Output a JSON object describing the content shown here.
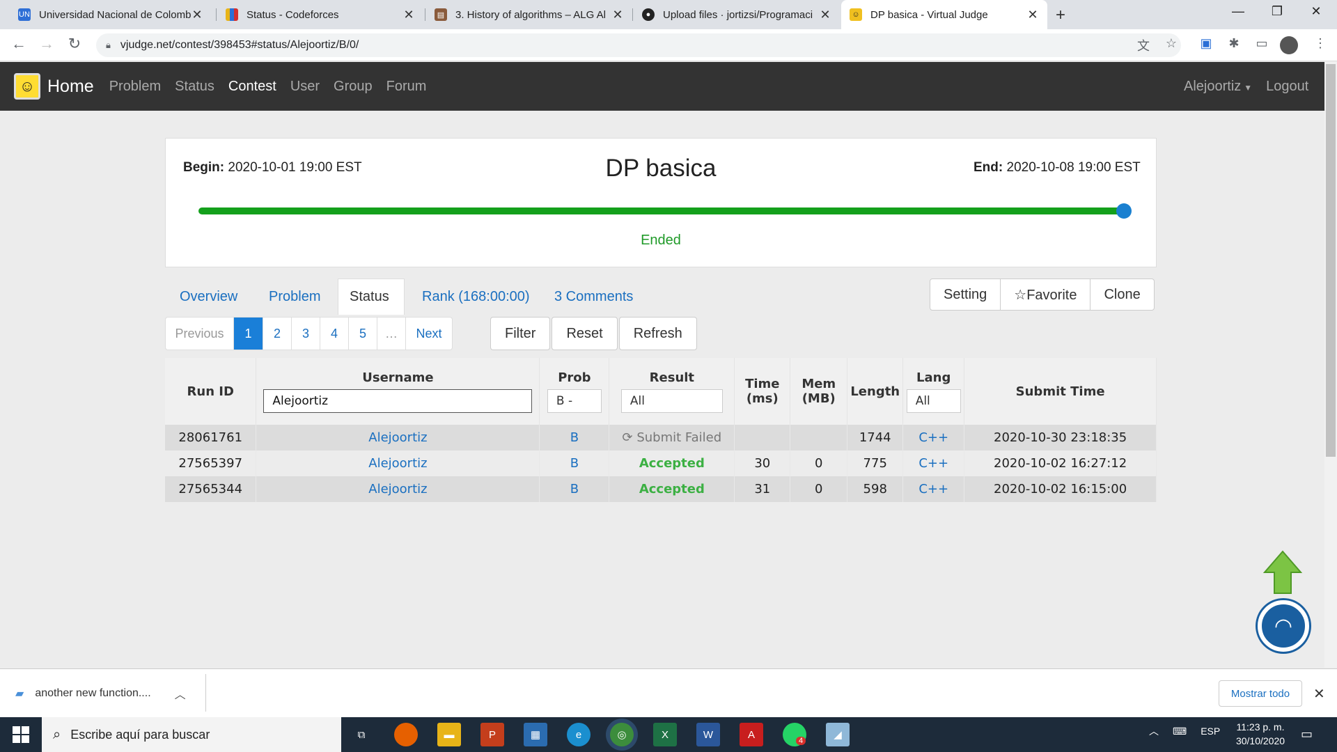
{
  "browser": {
    "tabs": [
      {
        "title": "Universidad Nacional de Colomb",
        "favicon": "unal-icon",
        "color": "#2f6fd6"
      },
      {
        "title": "Status - Codeforces",
        "favicon": "codeforces-icon",
        "color": "#e8b418"
      },
      {
        "title": "3. History of algorithms – ALG Al",
        "favicon": "book-icon",
        "color": "#8a5b3c"
      },
      {
        "title": "Upload files · jortizsi/Programaci",
        "favicon": "github-icon",
        "color": "#222222"
      },
      {
        "title": "DP basica - Virtual Judge",
        "favicon": "vjudge-icon",
        "color": "#f0c020"
      }
    ],
    "url": "vjudge.net/contest/398453#status/Alejoortiz/B/0/"
  },
  "nav": {
    "brand": "Home",
    "links": [
      "Problem",
      "Status",
      "Contest",
      "User",
      "Group",
      "Forum"
    ],
    "active": "Contest",
    "user": "Alejoortiz",
    "logout": "Logout"
  },
  "contest": {
    "title": "DP basica",
    "begin_label": "Begin:",
    "begin": "2020-10-01 19:00 EST",
    "end_label": "End:",
    "end": "2020-10-08 19:00 EST",
    "state": "Ended",
    "progress": 1.0
  },
  "tabs": {
    "overview": "Overview",
    "problem": "Problem",
    "status": "Status",
    "rank": "Rank (168:00:00)",
    "comments": "3 Comments"
  },
  "tab_buttons": {
    "setting": "Setting",
    "favorite": "☆Favorite",
    "clone": "Clone"
  },
  "pager": {
    "previous": "Previous",
    "pages": [
      "1",
      "2",
      "3",
      "4",
      "5",
      "…"
    ],
    "next": "Next",
    "current": "1"
  },
  "actions": {
    "filter": "Filter",
    "reset": "Reset",
    "refresh": "Refresh"
  },
  "table": {
    "headers": {
      "run_id": "Run ID",
      "username": "Username",
      "prob": "Prob",
      "result": "Result",
      "time_1": "Time",
      "time_2": "(ms)",
      "mem_1": "Mem",
      "mem_2": "(MB)",
      "length": "Length",
      "lang": "Lang",
      "submit_time": "Submit Time"
    },
    "filters": {
      "username": "Alejoortiz",
      "prob": "B -",
      "result": "All",
      "lang": "All"
    },
    "rows": [
      {
        "run_id": "28061761",
        "username": "Alejoortiz",
        "prob": "B",
        "result": "Submit Failed",
        "time": "",
        "mem": "",
        "length": "1744",
        "lang": "C++",
        "submit_time": "2020-10-30 23:18:35"
      },
      {
        "run_id": "27565397",
        "username": "Alejoortiz",
        "prob": "B",
        "result": "Accepted",
        "time": "30",
        "mem": "0",
        "length": "775",
        "lang": "C++",
        "submit_time": "2020-10-02 16:27:12"
      },
      {
        "run_id": "27565344",
        "username": "Alejoortiz",
        "prob": "B",
        "result": "Accepted",
        "time": "31",
        "mem": "0",
        "length": "598",
        "lang": "C++",
        "submit_time": "2020-10-02 16:15:00"
      }
    ]
  },
  "download": {
    "file": "another new function....",
    "show_all": "Mostrar todo"
  },
  "taskbar": {
    "search_placeholder": "Escribe aquí para buscar",
    "lang": "ESP",
    "time": "11:23 p. m.",
    "date": "30/10/2020",
    "whatsapp_badge": "4"
  },
  "colors": {
    "accent": "#1a6fc0",
    "accepted": "#3cb043",
    "progress": "#14a01c",
    "navbar": "#333333"
  }
}
